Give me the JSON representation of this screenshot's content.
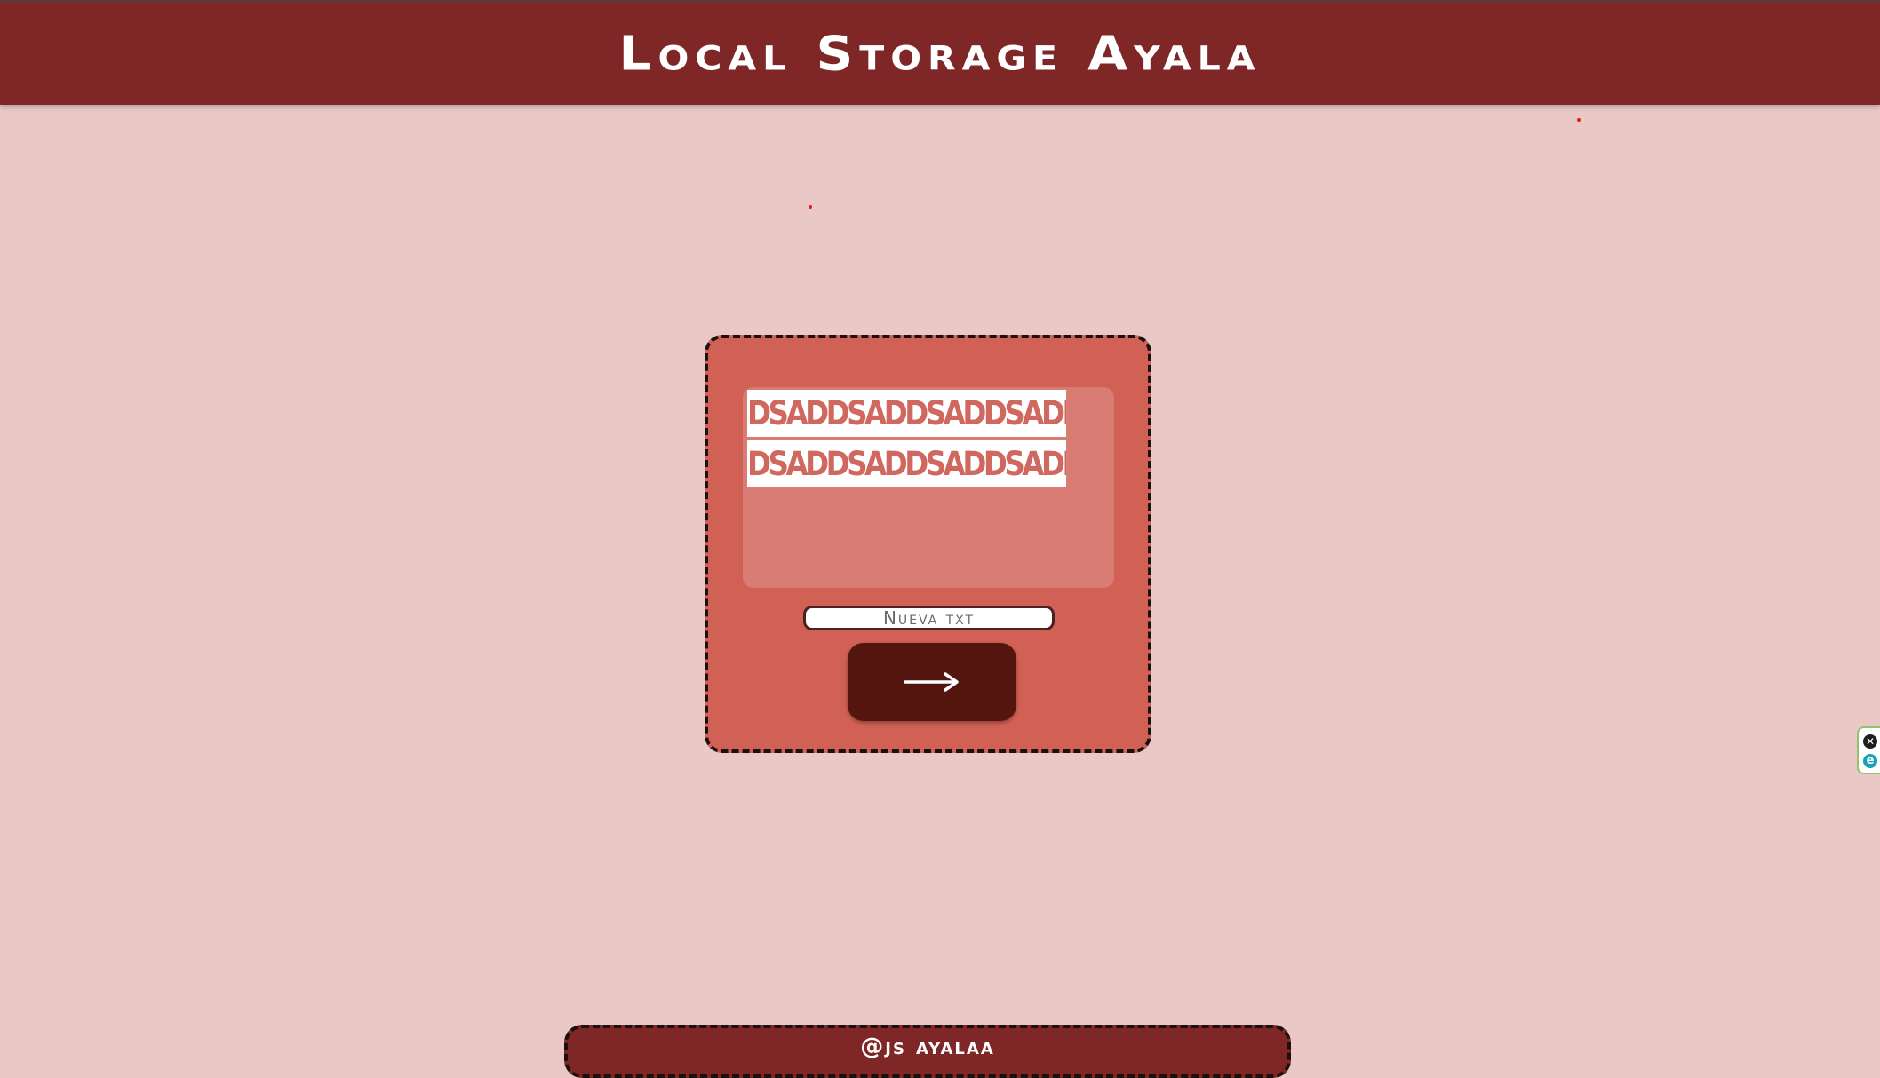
{
  "header": {
    "title": "Local Storage Ayala"
  },
  "card": {
    "saved_lines": [
      "DSADDSADDSADDSADDSADDSADDSAD",
      "DSADDSADDSADDSADDSADDSADDSAD"
    ],
    "input": {
      "placeholder": "Nueva txt",
      "value": ""
    },
    "send_button": {
      "icon": "arrow-right-icon",
      "symbol": "→"
    }
  },
  "footer": {
    "handle": "@js ayalaa"
  },
  "extension_widget": {
    "close_symbol": "✕",
    "badge_symbol": "e"
  },
  "colors": {
    "background": "#e9c8c6",
    "header": "#7f2727",
    "card": "#d16154",
    "output_area": "#d97c73",
    "button": "#54150f"
  }
}
